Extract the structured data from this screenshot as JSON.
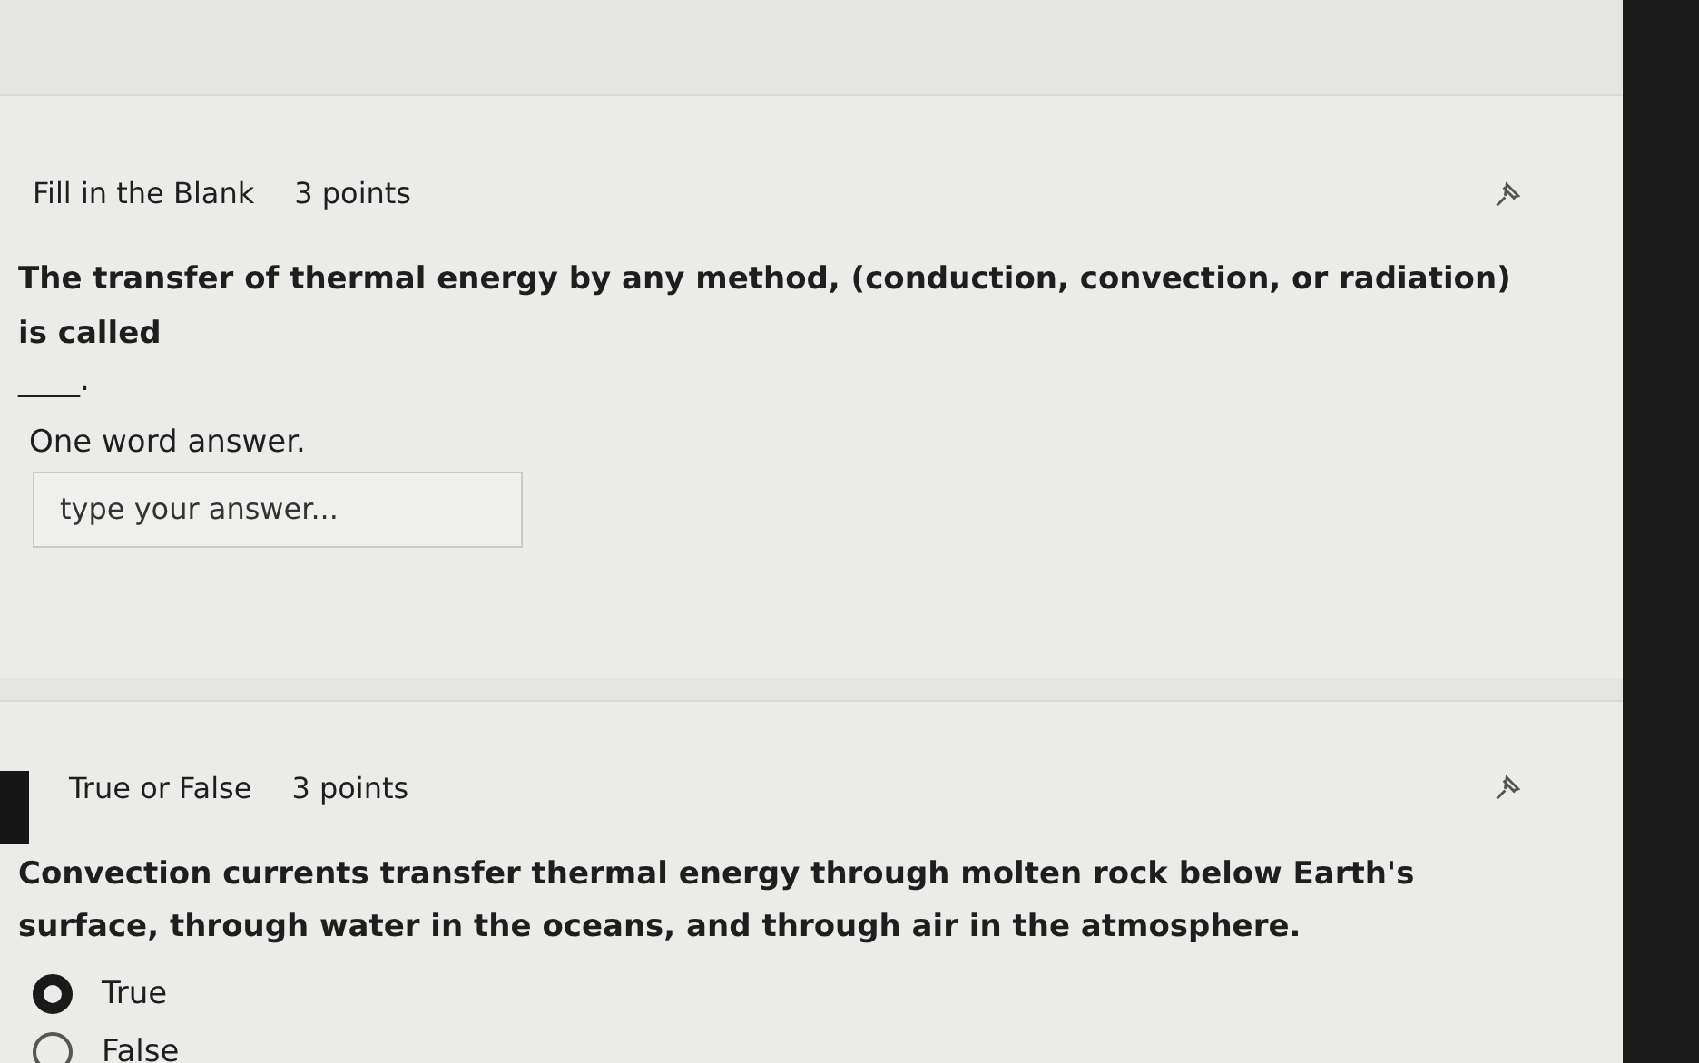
{
  "questions": [
    {
      "kind": "fill_blank",
      "type_label": "Fill in the Blank",
      "points": "3 points",
      "current": false,
      "prompt": "The transfer of thermal energy by any method, (conduction, convection, or radiation) is called",
      "blank": "____.",
      "instruction": "One word answer.",
      "answer": {
        "placeholder": "type your answer..."
      }
    },
    {
      "kind": "choice",
      "type_label": "True or False",
      "points": "3 points",
      "current": true,
      "prompt": "Convection currents transfer thermal energy through molten rock below Earth's surface, through water in the oceans, and through air in the atmosphere.",
      "options": [
        {
          "label": "True",
          "selected": true
        },
        {
          "label": "False",
          "selected": false
        }
      ]
    }
  ]
}
